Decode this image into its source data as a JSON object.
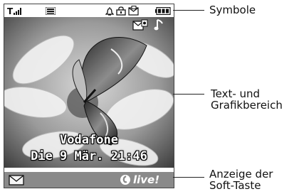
{
  "screen": {
    "network_name": "Vodafone",
    "date_time": "Die 9 Mär. 21:46"
  },
  "softkey": {
    "brand_label": "live!"
  },
  "callouts": [
    {
      "label": "Symbole"
    },
    {
      "label": "Text- und\nGrafikbereich"
    },
    {
      "label": "Anzeige der\nSoft-Taste"
    }
  ],
  "icons": [
    "signal-strength-icon",
    "network-3g-icon",
    "alarm-icon",
    "lock-icon",
    "message-icon",
    "battery-icon",
    "mms-icon",
    "music-note-icon",
    "envelope-icon",
    "vodafone-logo-icon"
  ],
  "colors": {
    "softkey_bar": "#8a8a8a",
    "screen_overlay_text": "#ffffff"
  }
}
